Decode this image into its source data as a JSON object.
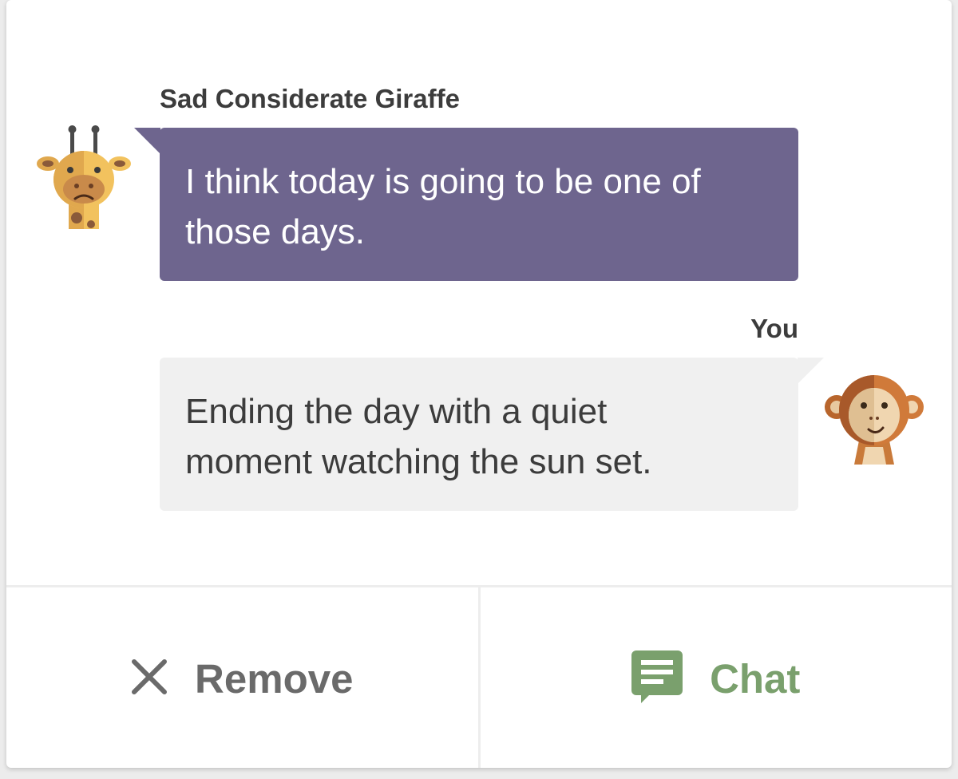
{
  "messages": [
    {
      "sender": "Sad Considerate Giraffe",
      "avatar": "giraffe-avatar-icon",
      "text_line1": "I think today is going to be one of",
      "text_line2": "those days."
    },
    {
      "sender": "You",
      "avatar": "monkey-avatar-icon",
      "text_line1": "Ending the day with a quiet",
      "text_line2": "moment watching the sun set."
    }
  ],
  "actions": {
    "remove_label": "Remove",
    "remove_icon": "close-icon",
    "chat_label": "Chat",
    "chat_icon": "chat-bubble-icon"
  },
  "colors": {
    "other_bubble": "#6e658e",
    "self_bubble": "#f0f0f0",
    "chat_accent": "#7aa06d",
    "remove_text": "#6a6a6a"
  }
}
